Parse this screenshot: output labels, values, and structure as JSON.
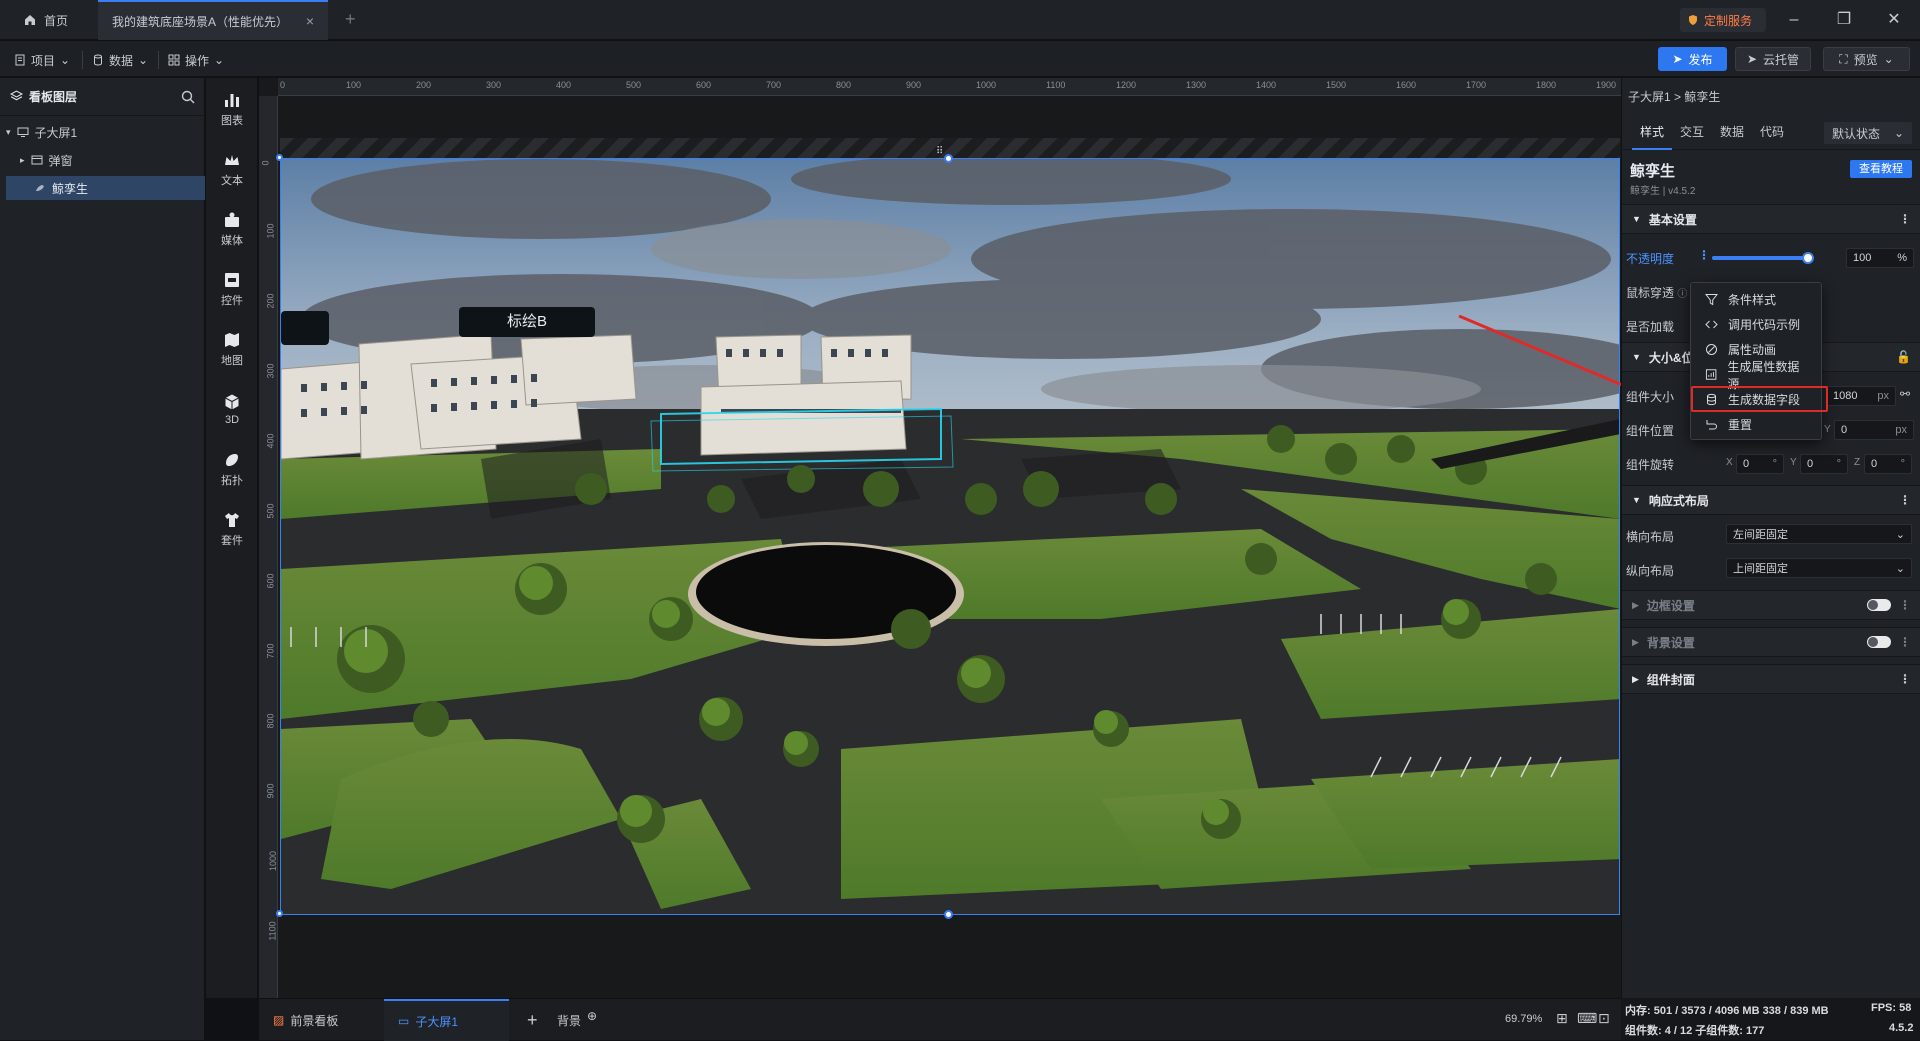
{
  "titlebar": {
    "home": "首页",
    "doc_tab": "我的建筑底座场景A（性能优先）",
    "custom_service": "定制服务"
  },
  "toolbar": {
    "project": "项目",
    "data": "数据",
    "operate": "操作",
    "publish": "发布",
    "cloud": "云托管",
    "preview": "预览"
  },
  "layers": {
    "title": "看板图层",
    "items": [
      {
        "label": "子大屏1"
      },
      {
        "label": "弹窗"
      },
      {
        "label": "鲸孪生"
      }
    ]
  },
  "categories": [
    "图表",
    "文本",
    "媒体",
    "控件",
    "地图",
    "3D",
    "拓扑",
    "套件"
  ],
  "ruler": {
    "top": [
      "0",
      "100",
      "200",
      "300",
      "400",
      "500",
      "600",
      "700",
      "800",
      "900",
      "1000",
      "1100",
      "1200",
      "1300",
      "1400",
      "1500",
      "1600",
      "1700",
      "1800",
      "1900"
    ],
    "left": [
      "0",
      "100",
      "200",
      "300",
      "400",
      "500",
      "600",
      "700",
      "800",
      "900",
      "1000",
      "1100"
    ]
  },
  "scene": {
    "label_b": "标绘B"
  },
  "bottom": {
    "front_board": "前景看板",
    "sub_screen": "子大屏1",
    "add": "+",
    "background": "背景",
    "zoom": "69.79%"
  },
  "props": {
    "breadcrumb": "子大屏1 > 鲸孪生",
    "tabs": [
      "样式",
      "交互",
      "数据",
      "代码"
    ],
    "state": "默认状态",
    "comp_title": "鲸孪生",
    "comp_version": "鲸孪生 | v4.5.2",
    "tutorial": "查看教程",
    "basic": "基本设置",
    "opacity_label": "不透明度",
    "opacity_value": "100",
    "opacity_unit": "%",
    "opacity_fraction": 1.0,
    "mouse_label": "鼠标穿透",
    "load_label": "是否加载",
    "size_section": "大小&位",
    "size_label": "组件大小",
    "size_value": "1080",
    "size_unit": "px",
    "pos_label": "组件位置",
    "pos_y": "Y",
    "pos_value": "0",
    "pos_unit": "px",
    "rot_label": "组件旋转",
    "rot": [
      {
        "axis": "X",
        "value": "0",
        "unit": "°"
      },
      {
        "axis": "Y",
        "value": "0",
        "unit": "°"
      },
      {
        "axis": "Z",
        "value": "0",
        "unit": "°"
      }
    ],
    "responsive": "响应式布局",
    "h_label": "横向布局",
    "h_value": "左间距固定",
    "v_label": "纵向布局",
    "v_value": "上间距固定",
    "border": "边框设置",
    "bg": "背景设置",
    "cover": "组件封面"
  },
  "menu": {
    "items": [
      "条件样式",
      "调用代码示例",
      "属性动画",
      "生成属性数据源",
      "生成数据字段",
      "重置"
    ]
  },
  "status": {
    "mem": "内存:  501 / 3573 / 4096 MB  338 / 839 MB",
    "fps": "FPS:  58",
    "count": "组件数: 4 / 12   子组件数: 177",
    "version": "4.5.2"
  },
  "colors": {
    "accent": "#3b7ff5",
    "highlight": "#e02a2a",
    "arrow": "#e02a2a"
  }
}
